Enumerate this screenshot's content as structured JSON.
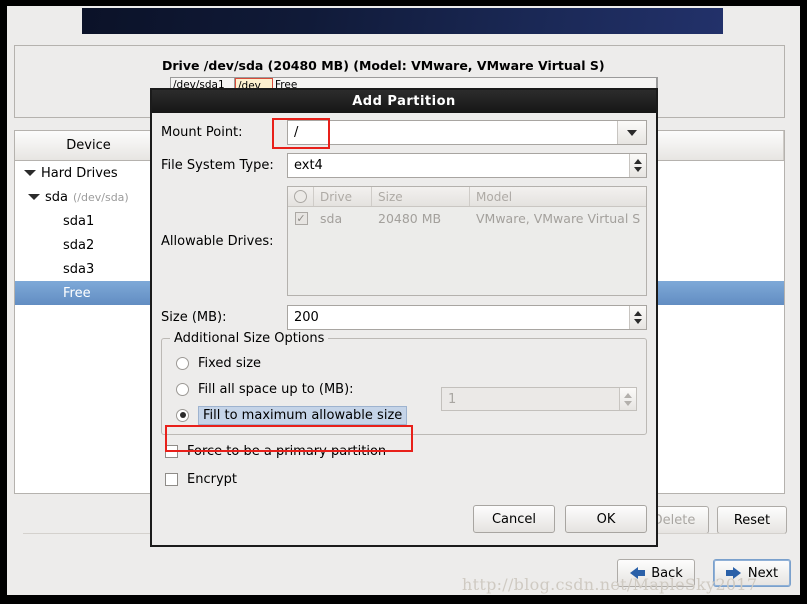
{
  "window": {
    "drive_summary": "Drive /dev/sda (20480 MB) (Model: VMware, VMware Virtual S)",
    "partition_bar": [
      {
        "label": "/dev/sda1",
        "selected": false
      },
      {
        "label": "/dev",
        "selected": true
      },
      {
        "label": "Free",
        "selected": false
      }
    ],
    "tree": {
      "columns": [
        "Device",
        ""
      ],
      "rows": [
        {
          "label": "Hard Drives",
          "path": "",
          "level": 0,
          "twisty": true,
          "selected": false
        },
        {
          "label": "sda",
          "path": "(/dev/sda)",
          "level": 1,
          "twisty": true,
          "selected": false
        },
        {
          "label": "sda1",
          "path": "",
          "level": 2,
          "twisty": false,
          "selected": false
        },
        {
          "label": "sda2",
          "path": "",
          "level": 2,
          "twisty": false,
          "selected": false
        },
        {
          "label": "sda3",
          "path": "",
          "level": 2,
          "twisty": false,
          "selected": false
        },
        {
          "label": "Free",
          "path": "",
          "level": 2,
          "twisty": false,
          "selected": true
        }
      ]
    },
    "actions": {
      "delete_label": "Delete",
      "reset_label": "Reset"
    },
    "nav": {
      "back_label": "Back",
      "next_label": "Next"
    },
    "watermark": "http://blog.csdn.net/MapleSky2017"
  },
  "dialog": {
    "title": "Add Partition",
    "mount_point": {
      "label": "Mount Point:",
      "value": "/",
      "icon": "chevron-down-icon"
    },
    "file_system_type": {
      "label": "File System Type:",
      "value": "ext4",
      "icon": "spinner-updown-icon"
    },
    "allowable_drives": {
      "label": "Allowable Drives:",
      "columns": [
        "",
        "Drive",
        "Size",
        "Model"
      ],
      "rows": [
        {
          "checked": true,
          "drive": "sda",
          "size": "20480 MB",
          "model": "VMware, VMware Virtual S"
        }
      ]
    },
    "size": {
      "label": "Size (MB):",
      "value": "200"
    },
    "additional_size_options": {
      "legend": "Additional Size Options",
      "options": [
        {
          "label": "Fixed size",
          "selected": false
        },
        {
          "label": "Fill all space up to (MB):",
          "selected": false
        },
        {
          "label": "Fill to maximum allowable size",
          "selected": true
        }
      ],
      "fill_up_to_value": "1"
    },
    "checkboxes": [
      {
        "label": "Force to be a primary partition",
        "checked": false
      },
      {
        "label": "Encrypt",
        "checked": false
      }
    ],
    "buttons": {
      "cancel_label": "Cancel",
      "ok_label": "OK"
    }
  },
  "colors": {
    "accent_blue": "#628dc2",
    "annotation_red": "#e8201a",
    "banner_navy": "#16224a",
    "window_bg": "#edeceb"
  }
}
